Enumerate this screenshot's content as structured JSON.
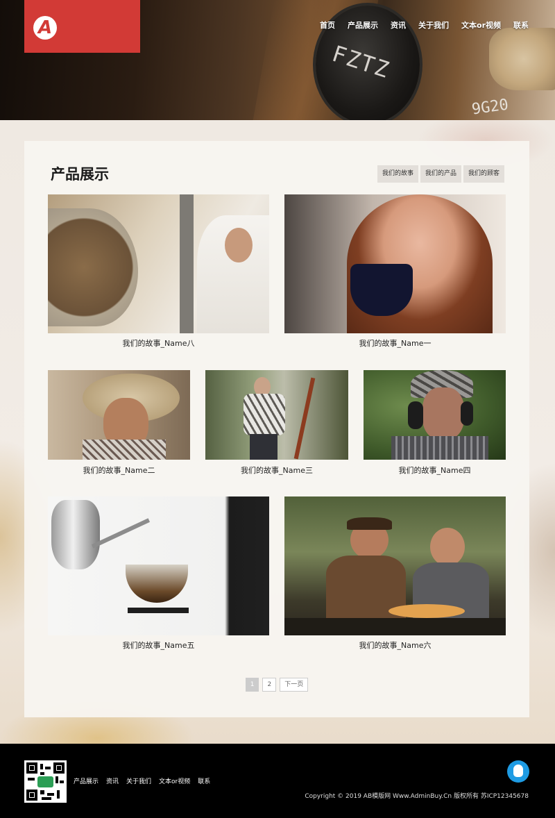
{
  "brand": {
    "logo_letter": "A"
  },
  "nav": [
    "首页",
    "产品展示",
    "资讯",
    "关于我们",
    "文本or视频",
    "联系"
  ],
  "hero": {
    "jar_text": "FZTZ",
    "crate_text": "9G20"
  },
  "section": {
    "title": "产品展示",
    "filters": [
      "我们的故事",
      "我们的产品",
      "我们的顾客"
    ]
  },
  "products": [
    {
      "caption": "我们的故事_Name八"
    },
    {
      "caption": "我们的故事_Name一"
    },
    {
      "caption": "我们的故事_Name二"
    },
    {
      "caption": "我们的故事_Name三"
    },
    {
      "caption": "我们的故事_Name四"
    },
    {
      "caption": "我们的故事_Name五"
    },
    {
      "caption": "我们的故事_Name六"
    }
  ],
  "pagination": {
    "pages": [
      "1",
      "2"
    ],
    "next": "下一页",
    "current": "1"
  },
  "footer": {
    "links": [
      "产品展示",
      "资讯",
      "关于我们",
      "文本or视频",
      "联系"
    ],
    "copyright": "Copyright © 2019 AB模版网 Www.AdminBuy.Cn 版权所有    苏ICP12345678"
  },
  "colors": {
    "brand_red": "#d23a36",
    "qq_blue": "#1e9be3",
    "footer_bg": "#000000"
  },
  "icons": {
    "logo": "brand-logo-icon",
    "qq": "qq-icon",
    "qr": "qr-code-icon"
  }
}
